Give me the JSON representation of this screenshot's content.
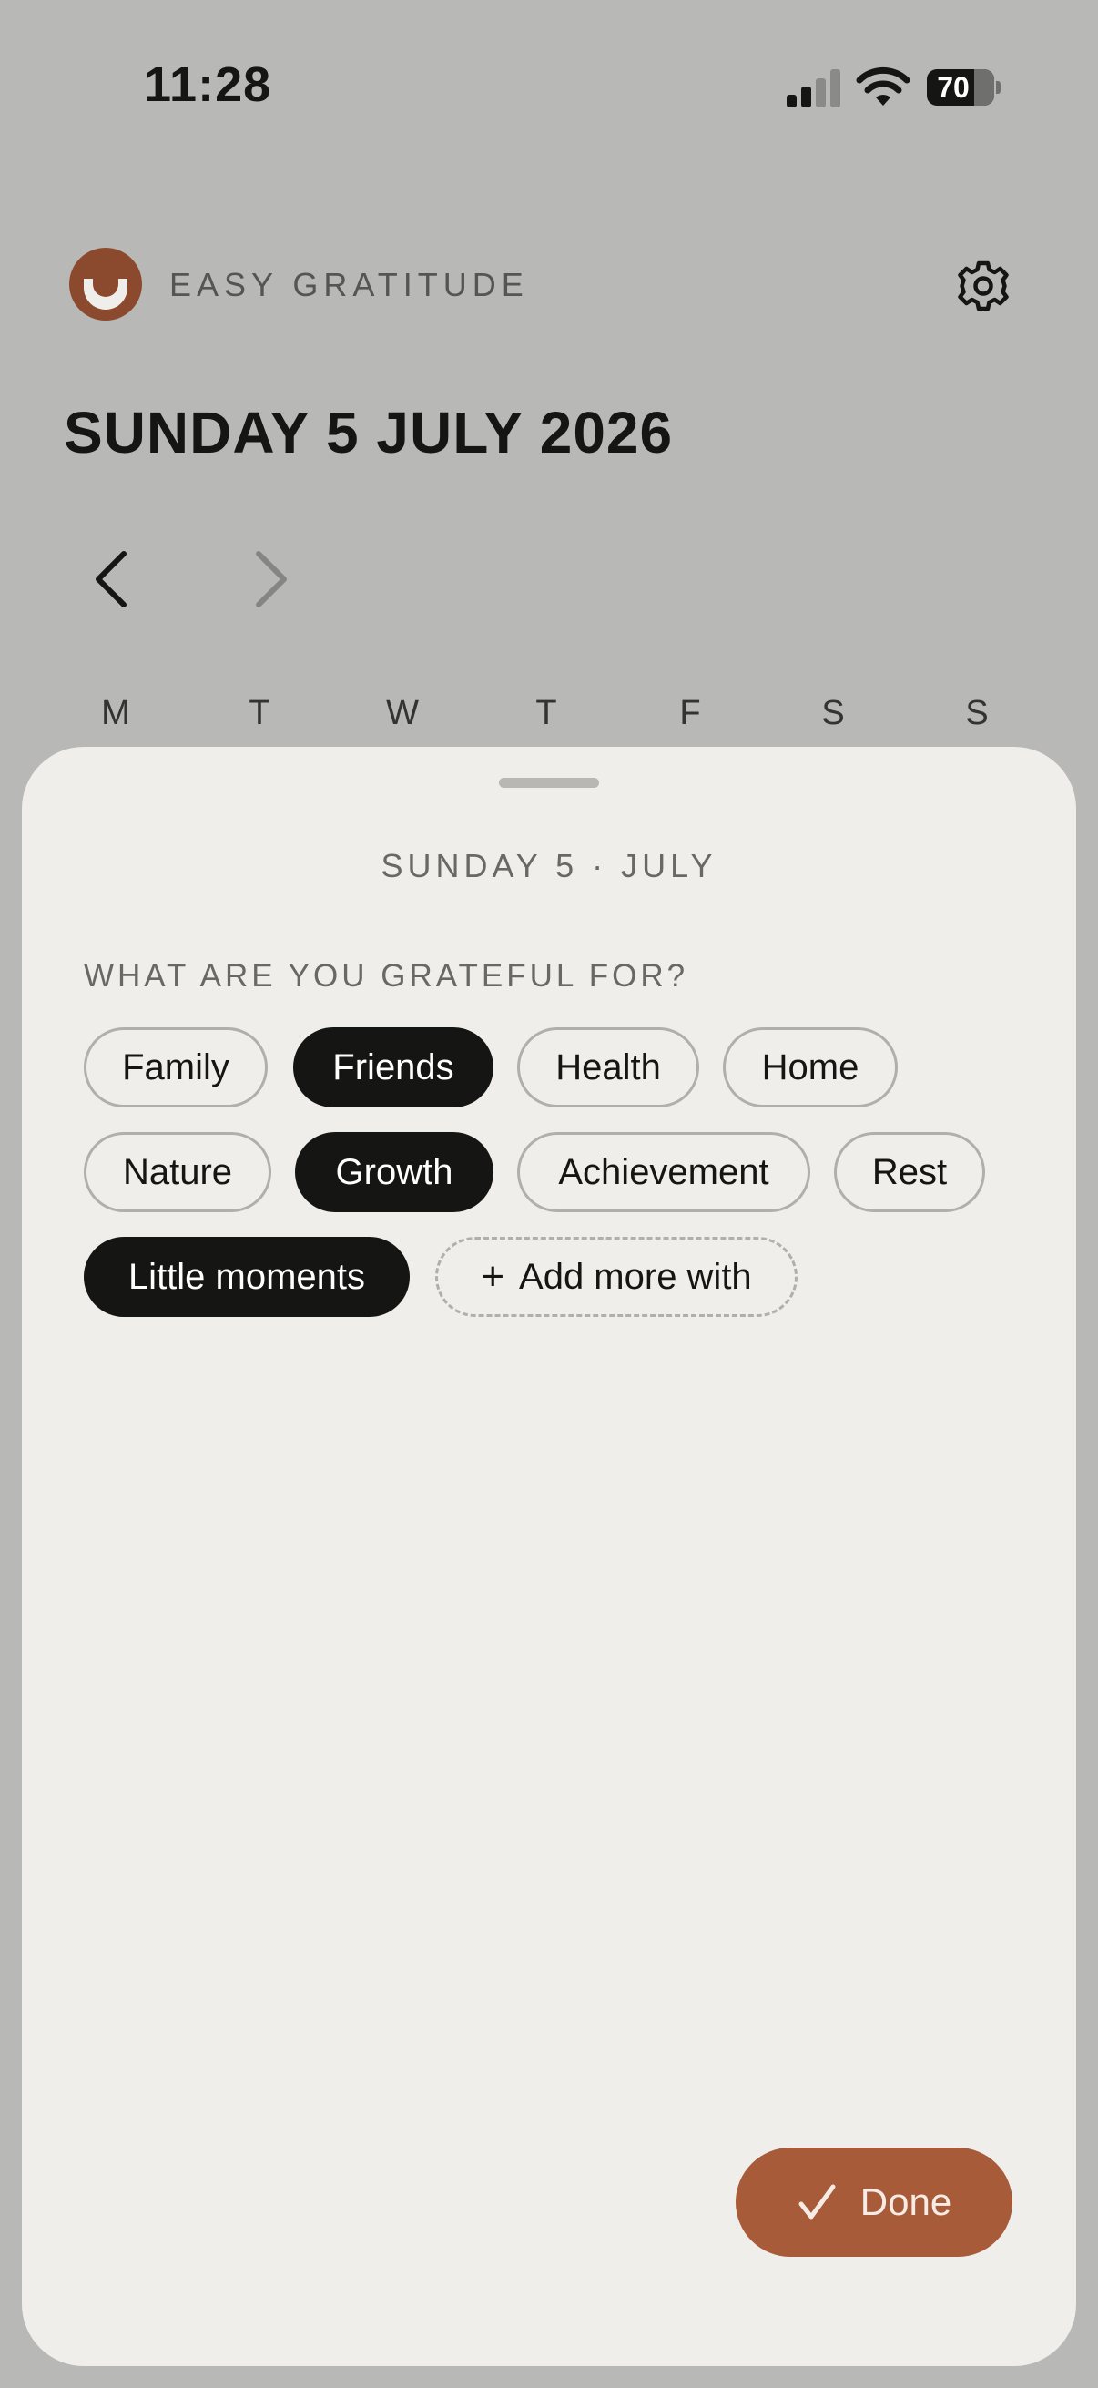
{
  "status_bar": {
    "time": "11:28",
    "battery": "70"
  },
  "header": {
    "app_name": "EASY GRATITUDE",
    "logo_icon": "eye-logo-icon",
    "settings_icon": "gear-icon"
  },
  "date_title": "SUNDAY 5 JULY 2026",
  "week_nav": {
    "prev_icon": "chevron-left-icon",
    "next_icon": "chevron-right-icon"
  },
  "weekdays": [
    "M",
    "T",
    "W",
    "T",
    "F",
    "S",
    "S"
  ],
  "sheet": {
    "date": "SUNDAY 5 · JULY",
    "prompt": "WHAT ARE YOU GRATEFUL FOR?",
    "chips": [
      {
        "label": "Family",
        "selected": false
      },
      {
        "label": "Friends",
        "selected": true
      },
      {
        "label": "Health",
        "selected": false
      },
      {
        "label": "Home",
        "selected": false
      },
      {
        "label": "Nature",
        "selected": false
      },
      {
        "label": "Growth",
        "selected": true
      },
      {
        "label": "Achievement",
        "selected": false
      },
      {
        "label": "Rest",
        "selected": false
      },
      {
        "label": "Little moments",
        "selected": true
      }
    ],
    "add_more": {
      "icon": "plus-icon",
      "plus": "+",
      "label": "Add more with"
    },
    "done": {
      "label": "Done",
      "icon": "checkmark-icon"
    }
  },
  "colors": {
    "accent": "#a75b39",
    "logo": "#8b4a2d",
    "sheet_bg": "#f0eeea",
    "selected_chip": "#151513",
    "backdrop": "#b8b8b6"
  }
}
